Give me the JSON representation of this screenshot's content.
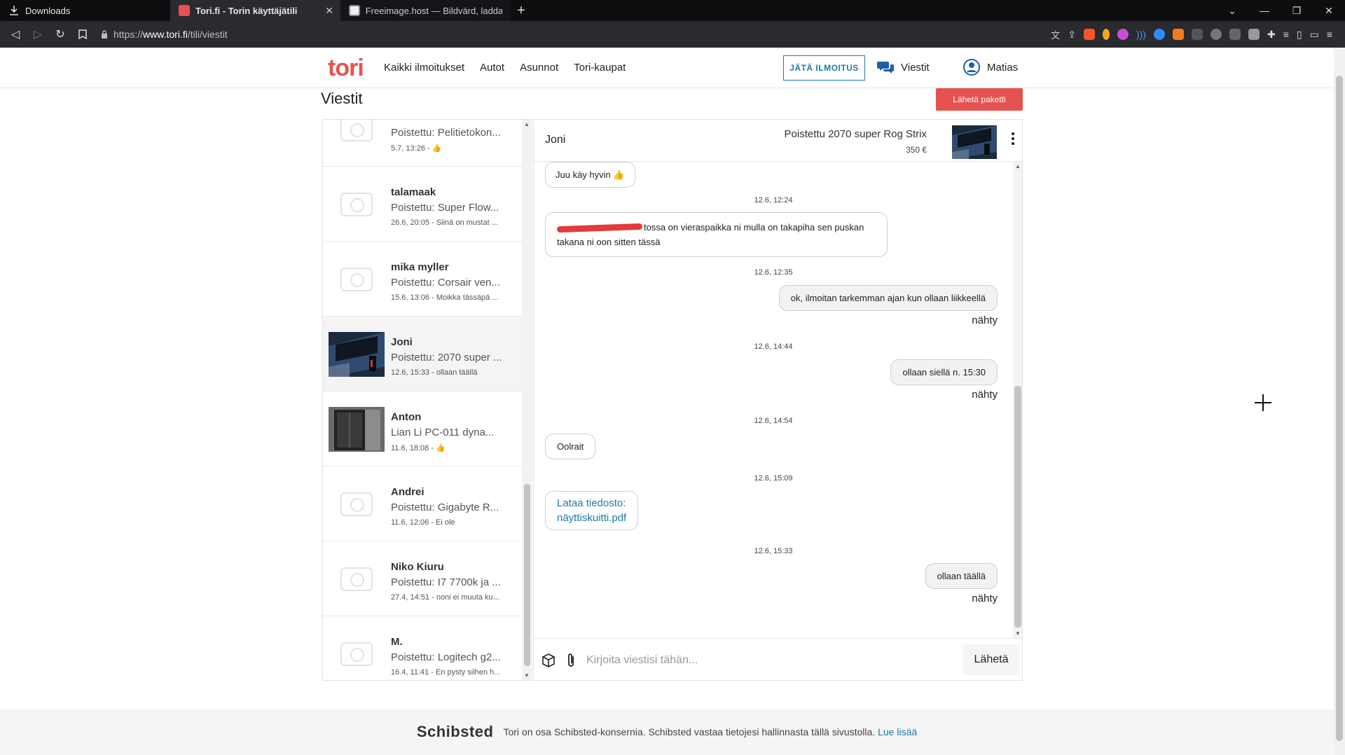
{
  "browser": {
    "tabs": [
      {
        "title": "Downloads",
        "icon": "download-icon"
      },
      {
        "title": "Tori.fi - Torin käyttäjätili",
        "icon": "tori-favicon",
        "active": true
      },
      {
        "title": "Freeimage.host — Bildvärd, ladda upp",
        "icon": "freeimage-favicon"
      }
    ],
    "url_prefix": "https://",
    "url_host": "www.tori.fi",
    "url_path": "/tili/viestit"
  },
  "header": {
    "logo": "tori",
    "nav": [
      "Kaikki ilmoitukset",
      "Autot",
      "Asunnot",
      "Tori-kaupat"
    ],
    "post_button": "JÄTÄ ILMOITUS",
    "messages_link": "Viestit",
    "user_name": "Matias",
    "brand_color": "#e5524f",
    "accent_color": "#1e7aa8"
  },
  "page": {
    "title": "Viestit",
    "send_package": "Lähetä paketti"
  },
  "conversations": [
    {
      "name": "",
      "subject": "Poistettu: Pelitietokon...",
      "meta": "5.7, 13:26 - 👍",
      "thumb": "placeholder"
    },
    {
      "name": "talamaak",
      "subject": "Poistettu: Super Flow...",
      "meta": "26.6, 20:05 - Siinä on mustat ...",
      "thumb": "placeholder"
    },
    {
      "name": "mika myller",
      "subject": "Poistettu: Corsair ven...",
      "meta": "15.6, 13:06 - Moikka tässäpä ...",
      "thumb": "placeholder"
    },
    {
      "name": "Joni",
      "subject": "Poistettu: 2070 super ...",
      "meta": "12.6, 15:33 - ollaan täällä",
      "thumb": "gpu",
      "selected": true
    },
    {
      "name": "Anton",
      "subject": "Lian Li PC-011 dyna...",
      "meta": "11.6, 18:08 - 👍",
      "thumb": "case"
    },
    {
      "name": "Andrei",
      "subject": "Poistettu: Gigabyte R...",
      "meta": "11.6, 12:06 - Ei ole",
      "thumb": "placeholder"
    },
    {
      "name": "Niko Kiuru",
      "subject": "Poistettu: I7 7700k ja ...",
      "meta": "27.4, 14:51 - noni ei muuta ku...",
      "thumb": "placeholder"
    },
    {
      "name": "M.",
      "subject": "Poistettu: Logitech g2...",
      "meta": "16.4, 11:41 - En pysty siihen h...",
      "thumb": "placeholder"
    }
  ],
  "chat": {
    "contact": "Joni",
    "ad_title": "Poistettu 2070 super Rog Strix",
    "ad_price": "350 €",
    "messages": {
      "m1": "Juu käy hyvin 👍",
      "ts1": "12.6, 12:24",
      "m2_line1": "tossa on vieraspaikka ni mulla on takapiha sen puskan",
      "m2_line2": "takana ni oon sitten tässä",
      "ts2": "12.6, 12:35",
      "m3": "ok, ilmoitan tarkemman ajan kun ollaan liikkeellä",
      "seen1": "nähty",
      "ts3": "12.6, 14:44",
      "m4": "ollaan siellä n. 15:30",
      "seen2": "nähty",
      "ts4": "12.6, 14:54",
      "m5": "Oolrait",
      "ts5": "12.6, 15:09",
      "m6_line1": "Lataa tiedosto:",
      "m6_line2": "näyttiskuitti.pdf",
      "ts6": "12.6, 15:33",
      "m7": "ollaan täällä",
      "seen3": "nähty"
    },
    "input_placeholder": "Kirjoita viestisi tähän...",
    "send_button": "Lähetä"
  },
  "footer": {
    "brand": "Schibsted",
    "text": "Tori on osa Schibsted-konsernia. Schibsted vastaa tietojesi hallinnasta tällä sivustolla.",
    "link": "Lue lisää"
  }
}
